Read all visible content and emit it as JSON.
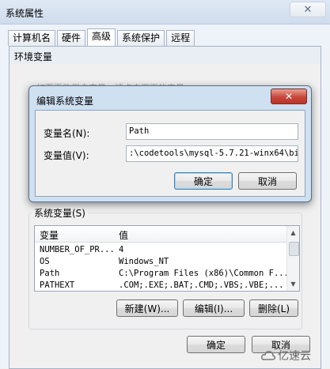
{
  "system_properties": {
    "title": "系统属性",
    "close_icon": "✕",
    "tabs": [
      "计算机名",
      "硬件",
      "高级",
      "系统保护",
      "远程"
    ],
    "active_tab": "高级"
  },
  "env_window": {
    "title": "环境变量",
    "faded_text": "如要更改用户变量，请点击下面的变量",
    "user_vars_label_fragment": "Administrator 的用户变量(U)"
  },
  "edit_dialog": {
    "title": "编辑系统变量",
    "close_icon": "✕",
    "name_label": "变量名(N):",
    "value_label": "变量值(V):",
    "name_value": "Path",
    "value_value": ":\\codetools\\mysql-5.7.21-winx64\\bin",
    "ok_label": "确定",
    "cancel_label": "取消"
  },
  "system_vars": {
    "group_label": "系统变量(S)",
    "col_variable": "变量",
    "col_value": "值",
    "rows": [
      {
        "name": "NUMBER_OF_PR...",
        "value": "4"
      },
      {
        "name": "OS",
        "value": "Windows_NT"
      },
      {
        "name": "Path",
        "value": "C:\\Program Files (x86)\\Common F..."
      },
      {
        "name": "PATHEXT",
        "value": ".COM;.EXE;.BAT;.CMD;.VBS;.VBE;..."
      }
    ],
    "new_label": "新建(W)...",
    "edit_label": "编辑(I)...",
    "delete_label": "删除(L)"
  },
  "env_bottom": {
    "ok_label": "确定",
    "cancel_label": "取消"
  },
  "watermark": "亿速云"
}
